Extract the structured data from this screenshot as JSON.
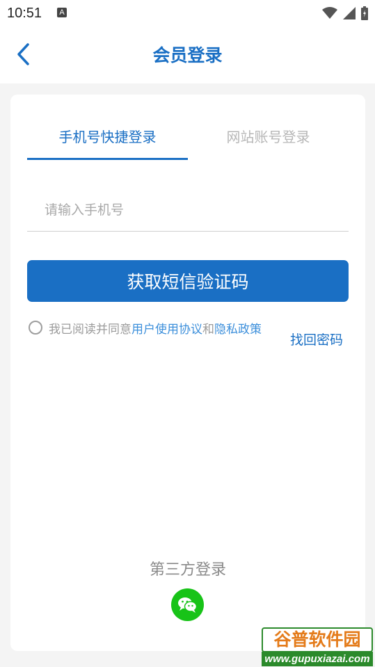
{
  "status_bar": {
    "time": "10:51",
    "notification_letter": "A",
    "icons": [
      "wifi-icon",
      "signal-icon",
      "battery-icon"
    ]
  },
  "header": {
    "title": "会员登录",
    "back_icon": "chevron-left-icon"
  },
  "tabs": [
    {
      "label": "手机号快捷登录",
      "active": true
    },
    {
      "label": "网站账号登录",
      "active": false
    }
  ],
  "phone_input": {
    "placeholder": "请输入手机号",
    "value": ""
  },
  "sms_button": {
    "label": "获取短信验证码"
  },
  "agreement": {
    "prefix": "我已阅读并同意",
    "user_agreement": "用户使用协议",
    "and": "和",
    "privacy_policy": "隐私政策",
    "checked": false
  },
  "find_password": "找回密码",
  "third_party": {
    "title": "第三方登录",
    "providers": [
      "wechat-icon"
    ]
  },
  "watermark": {
    "brand": "谷普软件园",
    "url": "www.gupuxiazai.com"
  },
  "colors": {
    "accent": "#1a6fc4",
    "link": "#3c8fdb",
    "wechat": "#18c318",
    "page_bg": "#f4f4f4"
  }
}
